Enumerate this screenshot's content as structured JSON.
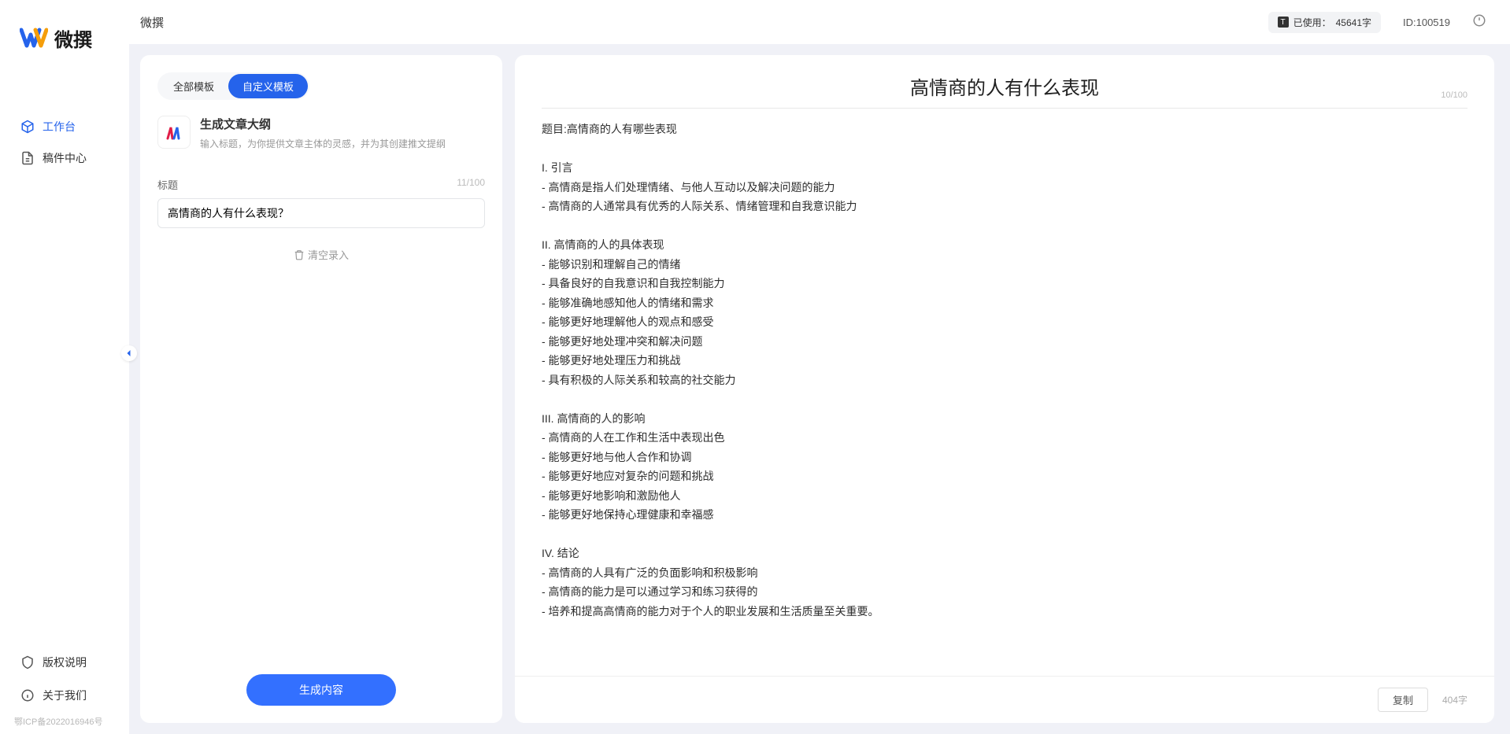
{
  "app_name": "微撰",
  "topbar": {
    "title": "微撰",
    "usage_prefix": "已使用：",
    "usage_value": "45641字",
    "id_label": "ID:100519"
  },
  "sidebar": {
    "logo_text": "微撰",
    "nav": [
      {
        "label": "工作台",
        "active": true
      },
      {
        "label": "稿件中心",
        "active": false
      }
    ],
    "footer": [
      {
        "label": "版权说明"
      },
      {
        "label": "关于我们"
      }
    ],
    "icp": "鄂ICP备2022016946号"
  },
  "left_panel": {
    "tabs": [
      {
        "label": "全部模板",
        "active": false
      },
      {
        "label": "自定义模板",
        "active": true
      }
    ],
    "template": {
      "title": "生成文章大纲",
      "desc": "输入标题，为你提供文章主体的灵感，并为其创建推文提纲"
    },
    "input_label": "标题",
    "input_counter": "11/100",
    "input_value": "高情商的人有什么表现？",
    "clear_label": "清空录入",
    "generate_label": "生成内容"
  },
  "right_panel": {
    "title": "高情商的人有什么表现",
    "title_counter": "10/100",
    "output_text": "题目:高情商的人有哪些表现\n\nI. 引言\n- 高情商是指人们处理情绪、与他人互动以及解决问题的能力\n- 高情商的人通常具有优秀的人际关系、情绪管理和自我意识能力\n\nII. 高情商的人的具体表现\n- 能够识别和理解自己的情绪\n- 具备良好的自我意识和自我控制能力\n- 能够准确地感知他人的情绪和需求\n- 能够更好地理解他人的观点和感受\n- 能够更好地处理冲突和解决问题\n- 能够更好地处理压力和挑战\n- 具有积极的人际关系和较高的社交能力\n\nIII. 高情商的人的影响\n- 高情商的人在工作和生活中表现出色\n- 能够更好地与他人合作和协调\n- 能够更好地应对复杂的问题和挑战\n- 能够更好地影响和激励他人\n- 能够更好地保持心理健康和幸福感\n\nIV. 结论\n- 高情商的人具有广泛的负面影响和积极影响\n- 高情商的能力是可以通过学习和练习获得的\n- 培养和提高高情商的能力对于个人的职业发展和生活质量至关重要。",
    "copy_label": "复制",
    "word_count": "404字"
  }
}
